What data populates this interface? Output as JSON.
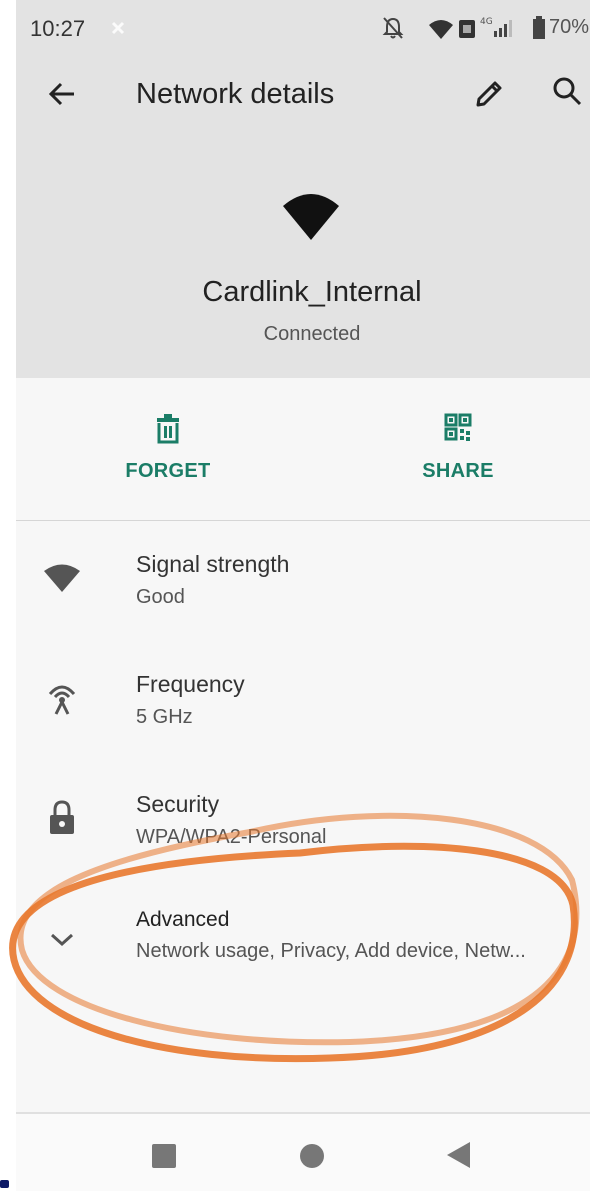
{
  "status_bar": {
    "time": "10:27",
    "battery": "70%",
    "icons": [
      "x-icon",
      "bell-off-icon",
      "wifi-icon",
      "sim-icon",
      "4g-icon",
      "signal-icon",
      "battery-icon"
    ]
  },
  "app_bar": {
    "title": "Network details",
    "back_icon": "arrow-left-icon",
    "edit_icon": "pencil-icon",
    "search_icon": "search-icon"
  },
  "network": {
    "name": "Cardlink_Internal",
    "status": "Connected"
  },
  "actions": [
    {
      "label": "FORGET",
      "icon": "trash-icon"
    },
    {
      "label": "SHARE",
      "icon": "qr-code-icon"
    }
  ],
  "details": [
    {
      "title": "Signal strength",
      "value": "Good",
      "icon": "wifi-icon"
    },
    {
      "title": "Frequency",
      "value": "5 GHz",
      "icon": "antenna-icon"
    },
    {
      "title": "Security",
      "value": "WPA/WPA2-Personal",
      "icon": "lock-icon"
    },
    {
      "title": "Advanced",
      "value": "Network usage, Privacy, Add device, Netw...",
      "icon": "chevron-down-icon"
    }
  ],
  "nav_bar": {
    "icons": [
      "recents-square-icon",
      "home-circle-icon",
      "back-triangle-icon"
    ]
  },
  "colors": {
    "accent": "#1b7d67",
    "header_bg": "#e3e3e3",
    "annotation": "#e8782e"
  }
}
